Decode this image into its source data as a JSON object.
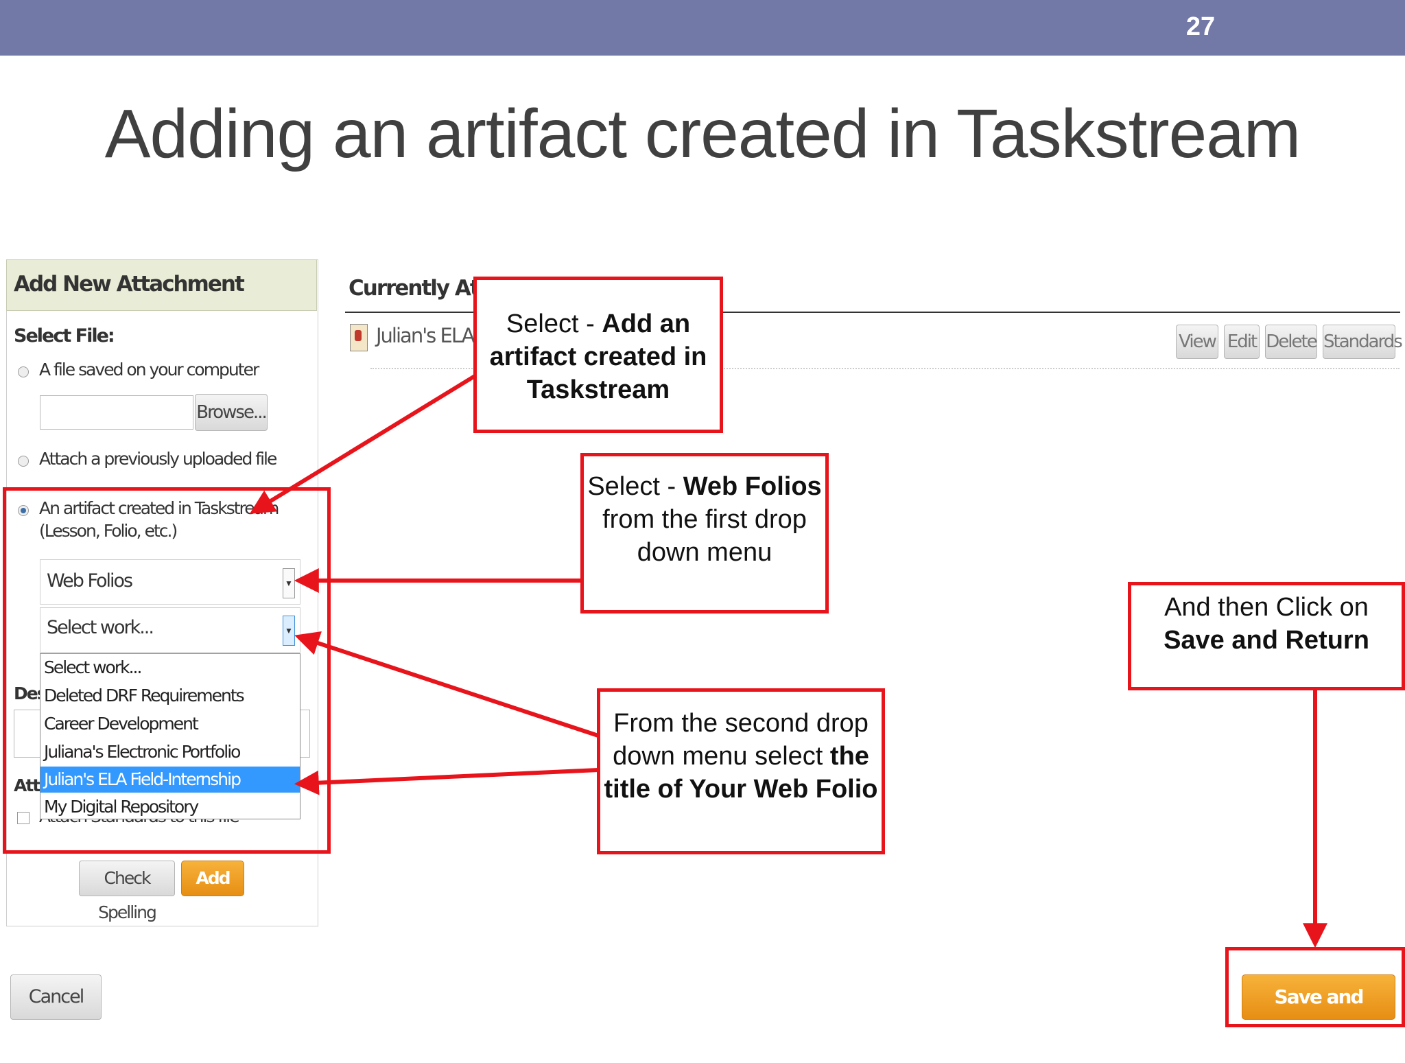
{
  "slide": {
    "number": "27",
    "title": "Adding an artifact created in Taskstream"
  },
  "panel": {
    "header": "Add New Attachment",
    "select_file_label": "Select File:",
    "option_computer": "A file saved on your computer",
    "browse_label": "Browse...",
    "option_previous": "Attach a previously uploaded file",
    "option_artifact_line1": "An artifact created in Taskstream",
    "option_artifact_line2": "(Lesson, Folio, etc.)",
    "select1_value": "Web Folios",
    "select2_value": "Select work...",
    "dropdown_options": [
      "Select work...",
      "Deleted DRF Requirements",
      "Career Development",
      "Juliana's Electronic Portfolio",
      "Julian's ELA Field-Internship Portfolio",
      "My Digital Repository"
    ],
    "dropdown_selected_index": 4,
    "description_label_partial": "Des",
    "attach_label_partial": "Atta",
    "attach_standards_partial": "Attach Standards to this file",
    "check_spelling_label": "Check Spelling",
    "add_file_label": "Add File",
    "cancel_label": "Cancel"
  },
  "attachments": {
    "heading_partial": "Currently Attach",
    "item_partial": "Julian's ELA F",
    "buttons": [
      "View",
      "Edit",
      "Delete",
      "Standards"
    ]
  },
  "save_return_label": "Save and Return",
  "callouts": {
    "c1": {
      "plain1": "Select - ",
      "bold1": "Add an artifact created in Taskstream"
    },
    "c2": {
      "plain1": "Select - ",
      "bold1": "Web Folios",
      "plain2": " from the first drop down menu"
    },
    "c3": {
      "plain1": "And then Click on ",
      "bold1": "Save and Return"
    },
    "c4": {
      "plain1": "From the second drop down menu select ",
      "bold1": "the title of Your Web Folio"
    }
  },
  "colors": {
    "topbar": "#7279a6",
    "annotation_red": "#e8141c",
    "button_orange": "#f0a02a",
    "highlight_blue": "#3399ff"
  }
}
